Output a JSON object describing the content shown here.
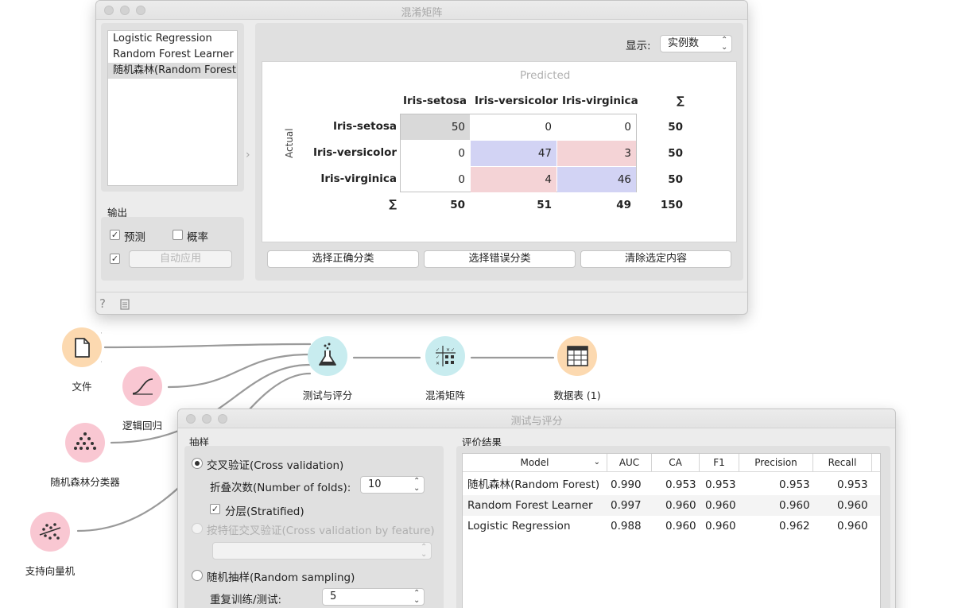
{
  "confusion_window": {
    "title": "混淆矩阵",
    "learners": [
      "Logistic Regression",
      "Random Forest Learner",
      "随机森林(Random Forest)"
    ],
    "selected_learner_index": 2,
    "show_label": "显示:",
    "show_value": "实例数",
    "output_label": "输出",
    "predictions_label": "预测",
    "predictions_checked": true,
    "probabilities_label": "概率",
    "probabilities_checked": false,
    "auto_apply_checked": true,
    "auto_apply_label": "自动应用",
    "predicted_label": "Predicted",
    "actual_label": "Actual",
    "sum_symbol": "∑",
    "class_names": [
      "Iris-setosa",
      "Iris-versicolor",
      "Iris-virginica"
    ],
    "matrix": [
      [
        "50",
        "0",
        "0"
      ],
      [
        "0",
        "47",
        "3"
      ],
      [
        "0",
        "4",
        "46"
      ]
    ],
    "row_sums": [
      "50",
      "50",
      "50"
    ],
    "col_sums": [
      "50",
      "51",
      "49"
    ],
    "total": "150",
    "select_correct_label": "选择正确分类",
    "select_misclassified_label": "选择错误分类",
    "clear_selection_label": "清除选定内容",
    "colors": {
      "diag_grey": "#d9d9d9",
      "blue": "#d2d3f4",
      "red": "#f4d3d6"
    }
  },
  "canvas": {
    "nodes": [
      {
        "id": "file",
        "label": "文件",
        "icon": "file-icon"
      },
      {
        "id": "logreg",
        "label": "逻辑回归",
        "icon": "logistic-curve-icon"
      },
      {
        "id": "rf",
        "label": "随机森林分类器",
        "icon": "tree-icon"
      },
      {
        "id": "svm",
        "label": "支持向量机",
        "icon": "svm-icon"
      },
      {
        "id": "test",
        "label": "测试与评分",
        "icon": "flask-icon"
      },
      {
        "id": "cm",
        "label": "混淆矩阵",
        "icon": "matrix-icon"
      },
      {
        "id": "table",
        "label": "数据表 (1)",
        "icon": "table-icon"
      }
    ]
  },
  "test_window": {
    "title": "测试与评分",
    "sampling_label": "抽样",
    "cv_label": "交叉验证(Cross validation)",
    "folds_label": "折叠次数(Number of folds):",
    "folds_value": "10",
    "stratified_label": "分层(Stratified)",
    "stratified_checked": true,
    "cv_feature_label": "按特征交叉验证(Cross validation by feature)",
    "random_sampling_label": "随机抽样(Random sampling)",
    "repeat_label": "重复训练/测试:",
    "repeat_value": "5",
    "results_label": "评价结果",
    "columns": [
      "Model",
      "AUC",
      "CA",
      "F1",
      "Precision",
      "Recall"
    ],
    "rows": [
      [
        "随机森林(Random Forest)",
        "0.990",
        "0.953",
        "0.953",
        "0.953",
        "0.953"
      ],
      [
        "Random Forest Learner",
        "0.997",
        "0.960",
        "0.960",
        "0.960",
        "0.960"
      ],
      [
        "Logistic Regression",
        "0.988",
        "0.960",
        "0.960",
        "0.962",
        "0.960"
      ]
    ]
  }
}
